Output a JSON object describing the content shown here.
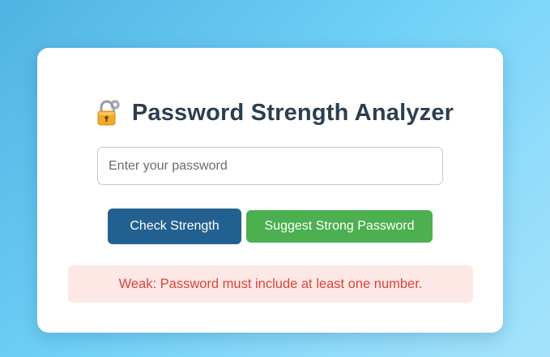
{
  "app": {
    "title": "Password Strength Analyzer",
    "title_icon": "lock-with-key-icon"
  },
  "form": {
    "password_placeholder": "Enter your password",
    "password_value": ""
  },
  "buttons": {
    "check_label": "Check Strength",
    "suggest_label": "Suggest Strong Password"
  },
  "result": {
    "message": "Weak: Password must include at least one number.",
    "status": "weak"
  },
  "colors": {
    "title": "#2c3e50",
    "check_button": "#22618f",
    "suggest_button": "#4caf50",
    "result_background": "#fde8e6",
    "result_text": "#d9453a"
  }
}
